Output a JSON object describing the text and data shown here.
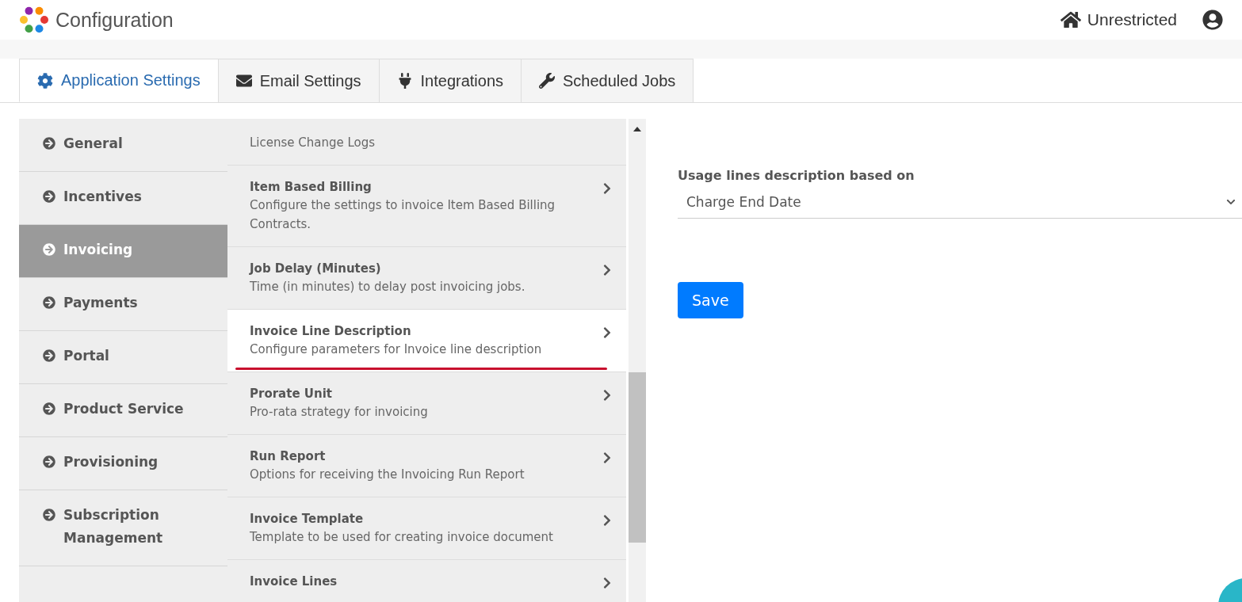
{
  "header": {
    "title": "Configuration",
    "access": "Unrestricted"
  },
  "tabs": [
    {
      "label": "Application Settings",
      "selected": true
    },
    {
      "label": "Email Settings",
      "selected": false
    },
    {
      "label": "Integrations",
      "selected": false
    },
    {
      "label": "Scheduled Jobs",
      "selected": false
    }
  ],
  "sidebar": {
    "items": [
      {
        "label": "General",
        "selected": false
      },
      {
        "label": "Incentives",
        "selected": false
      },
      {
        "label": "Invoicing",
        "selected": true
      },
      {
        "label": "Payments",
        "selected": false
      },
      {
        "label": "Portal",
        "selected": false
      },
      {
        "label": "Product Service",
        "selected": false
      },
      {
        "label": "Provisioning",
        "selected": false
      },
      {
        "label": "Subscription Management",
        "selected": false
      }
    ]
  },
  "settings_list": {
    "items": [
      {
        "description": "License Change Logs",
        "selected": false,
        "underlined": false
      },
      {
        "title": "Item Based Billing",
        "description": "Configure the settings to invoice Item Based Billing Contracts.",
        "selected": false,
        "underlined": false
      },
      {
        "title": "Job Delay (Minutes)",
        "description": "Time (in minutes) to delay post invoicing jobs.",
        "selected": false,
        "underlined": false
      },
      {
        "title": "Invoice Line Description",
        "description": "Configure parameters for Invoice line description",
        "selected": true,
        "underlined": true
      },
      {
        "title": "Prorate Unit",
        "description": "Pro-rata strategy for invoicing",
        "selected": false,
        "underlined": false
      },
      {
        "title": "Run Report",
        "description": "Options for receiving the Invoicing Run Report",
        "selected": false,
        "underlined": false
      },
      {
        "title": "Invoice Template",
        "description": "Template to be used for creating invoice document",
        "selected": false,
        "underlined": false
      },
      {
        "title": "Invoice Lines",
        "selected": false,
        "underlined": false
      }
    ]
  },
  "detail": {
    "field_label": "Usage lines description based on",
    "field_value": "Charge End Date",
    "save_button": "Save"
  }
}
